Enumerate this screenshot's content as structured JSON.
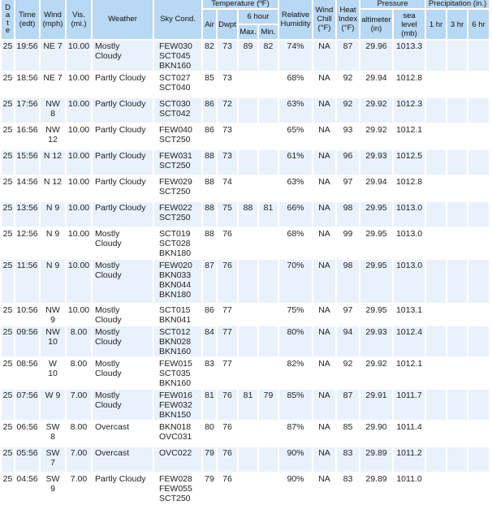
{
  "header": {
    "date": "D\na\nt\ne",
    "time": "Time\n(edt)",
    "wind": "Wind\n(mph)",
    "vis": "Vis.\n(mi.)",
    "weather": "Weather",
    "sky": "Sky Cond.",
    "temperature": "Temperature (ºF)",
    "air": "Air",
    "dwpt": "Dwpt",
    "six_hour": "6 hour",
    "max": "Max.",
    "min": "Min.",
    "rh": "Relative\nHumidity",
    "wind_chill": "Wind\nChill\n(°F)",
    "heat_index": "Heat\nIndex\n(°F)",
    "pressure": "Pressure",
    "altimeter": "altimeter\n(in)",
    "sea_level": "sea\nlevel\n(mb)",
    "precip": "Precipitation (in.)",
    "p1": "1 hr",
    "p3": "3 hr",
    "p6": "6 hr"
  },
  "rows": [
    {
      "date": "25",
      "time": "19:56",
      "wind": "NE 7",
      "vis": "10.00",
      "weather": "Mostly\nCloudy",
      "sky": "FEW030\nSCT045\nBKN160",
      "air": "82",
      "dwpt": "73",
      "max": "89",
      "min": "82",
      "rh": "74%",
      "chill": "NA",
      "heat": "87",
      "alt": "29.96",
      "slp": "1013.3",
      "p1": "",
      "p3": "",
      "p6": ""
    },
    {
      "date": "25",
      "time": "18:56",
      "wind": "NE 7",
      "vis": "10.00",
      "weather": "Partly Cloudy",
      "sky": "SCT027\nSCT040",
      "air": "85",
      "dwpt": "73",
      "max": "",
      "min": "",
      "rh": "68%",
      "chill": "NA",
      "heat": "92",
      "alt": "29.94",
      "slp": "1012.8",
      "p1": "",
      "p3": "",
      "p6": ""
    },
    {
      "date": "25",
      "time": "17:56",
      "wind": "NW\n8",
      "vis": "10.00",
      "weather": "Partly Cloudy",
      "sky": "SCT030\nSCT042",
      "air": "86",
      "dwpt": "72",
      "max": "",
      "min": "",
      "rh": "63%",
      "chill": "NA",
      "heat": "92",
      "alt": "29.92",
      "slp": "1012.3",
      "p1": "",
      "p3": "",
      "p6": ""
    },
    {
      "date": "25",
      "time": "16:56",
      "wind": "NW\n12",
      "vis": "10.00",
      "weather": "Partly Cloudy",
      "sky": "FEW040\nSCT250",
      "air": "86",
      "dwpt": "73",
      "max": "",
      "min": "",
      "rh": "65%",
      "chill": "NA",
      "heat": "93",
      "alt": "29.92",
      "slp": "1012.1",
      "p1": "",
      "p3": "",
      "p6": ""
    },
    {
      "date": "25",
      "time": "15:56",
      "wind": "N 12",
      "vis": "10.00",
      "weather": "Partly Cloudy",
      "sky": "FEW031\nSCT250",
      "air": "88",
      "dwpt": "73",
      "max": "",
      "min": "",
      "rh": "61%",
      "chill": "NA",
      "heat": "96",
      "alt": "29.93",
      "slp": "1012.5",
      "p1": "",
      "p3": "",
      "p6": ""
    },
    {
      "date": "25",
      "time": "14:56",
      "wind": "N 12",
      "vis": "10.00",
      "weather": "Partly Cloudy",
      "sky": "FEW029\nSCT250",
      "air": "88",
      "dwpt": "74",
      "max": "",
      "min": "",
      "rh": "63%",
      "chill": "NA",
      "heat": "97",
      "alt": "29.94",
      "slp": "1012.8",
      "p1": "",
      "p3": "",
      "p6": ""
    },
    {
      "date": "25",
      "time": "13:56",
      "wind": "N 9",
      "vis": "10.00",
      "weather": "Partly Cloudy",
      "sky": "FEW022\nSCT250",
      "air": "88",
      "dwpt": "75",
      "max": "88",
      "min": "81",
      "rh": "66%",
      "chill": "NA",
      "heat": "98",
      "alt": "29.95",
      "slp": "1013.0",
      "p1": "",
      "p3": "",
      "p6": ""
    },
    {
      "date": "25",
      "time": "12:56",
      "wind": "N 9",
      "vis": "10.00",
      "weather": "Mostly\nCloudy",
      "sky": "SCT019\nSCT028\nBKN180",
      "air": "88",
      "dwpt": "76",
      "max": "",
      "min": "",
      "rh": "68%",
      "chill": "NA",
      "heat": "99",
      "alt": "29.95",
      "slp": "1013.0",
      "p1": "",
      "p3": "",
      "p6": ""
    },
    {
      "date": "25",
      "time": "11:56",
      "wind": "N 9",
      "vis": "10.00",
      "weather": "Mostly\nCloudy",
      "sky": "FEW020\nBKN033\nBKN044\nBKN180",
      "air": "87",
      "dwpt": "76",
      "max": "",
      "min": "",
      "rh": "70%",
      "chill": "NA",
      "heat": "98",
      "alt": "29.95",
      "slp": "1013.0",
      "p1": "",
      "p3": "",
      "p6": ""
    },
    {
      "date": "25",
      "time": "10:56",
      "wind": "NW\n9",
      "vis": "10.00",
      "weather": "Mostly\nCloudy",
      "sky": "SCT015\nBKN041",
      "air": "86",
      "dwpt": "77",
      "max": "",
      "min": "",
      "rh": "75%",
      "chill": "NA",
      "heat": "97",
      "alt": "29.95",
      "slp": "1013.1",
      "p1": "",
      "p3": "",
      "p6": ""
    },
    {
      "date": "25",
      "time": "09:56",
      "wind": "NW\n10",
      "vis": "8.00",
      "weather": "Mostly\nCloudy",
      "sky": "SCT012\nBKN028\nBKN160",
      "air": "84",
      "dwpt": "77",
      "max": "",
      "min": "",
      "rh": "80%",
      "chill": "NA",
      "heat": "94",
      "alt": "29.93",
      "slp": "1012.4",
      "p1": "",
      "p3": "",
      "p6": ""
    },
    {
      "date": "25",
      "time": "08:56",
      "wind": "W\n10",
      "vis": "8.00",
      "weather": "Mostly\nCloudy",
      "sky": "FEW015\nSCT035\nBKN160",
      "air": "83",
      "dwpt": "77",
      "max": "",
      "min": "",
      "rh": "82%",
      "chill": "NA",
      "heat": "92",
      "alt": "29.92",
      "slp": "1012.1",
      "p1": "",
      "p3": "",
      "p6": ""
    },
    {
      "date": "25",
      "time": "07:56",
      "wind": "W 9",
      "vis": "7.00",
      "weather": "Mostly\nCloudy",
      "sky": "FEW016\nFEW032\nBKN150",
      "air": "81",
      "dwpt": "76",
      "max": "81",
      "min": "79",
      "rh": "85%",
      "chill": "NA",
      "heat": "87",
      "alt": "29.91",
      "slp": "1011.7",
      "p1": "",
      "p3": "",
      "p6": ""
    },
    {
      "date": "25",
      "time": "06:56",
      "wind": "SW\n8",
      "vis": "8.00",
      "weather": "Overcast",
      "sky": "BKN018\nOVC031",
      "air": "80",
      "dwpt": "76",
      "max": "",
      "min": "",
      "rh": "87%",
      "chill": "NA",
      "heat": "85",
      "alt": "29.90",
      "slp": "1011.4",
      "p1": "",
      "p3": "",
      "p6": ""
    },
    {
      "date": "25",
      "time": "05:56",
      "wind": "SW\n7",
      "vis": "7.00",
      "weather": "Overcast",
      "sky": "OVC022",
      "air": "79",
      "dwpt": "76",
      "max": "",
      "min": "",
      "rh": "90%",
      "chill": "NA",
      "heat": "83",
      "alt": "29.89",
      "slp": "1011.2",
      "p1": "",
      "p3": "",
      "p6": ""
    },
    {
      "date": "25",
      "time": "04:56",
      "wind": "SW\n9",
      "vis": "7.00",
      "weather": "Partly Cloudy",
      "sky": "FEW028\nFEW055\nSCT250",
      "air": "79",
      "dwpt": "76",
      "max": "",
      "min": "",
      "rh": "90%",
      "chill": "NA",
      "heat": "83",
      "alt": "29.89",
      "slp": "1011.0",
      "p1": "",
      "p3": "",
      "p6": ""
    }
  ]
}
